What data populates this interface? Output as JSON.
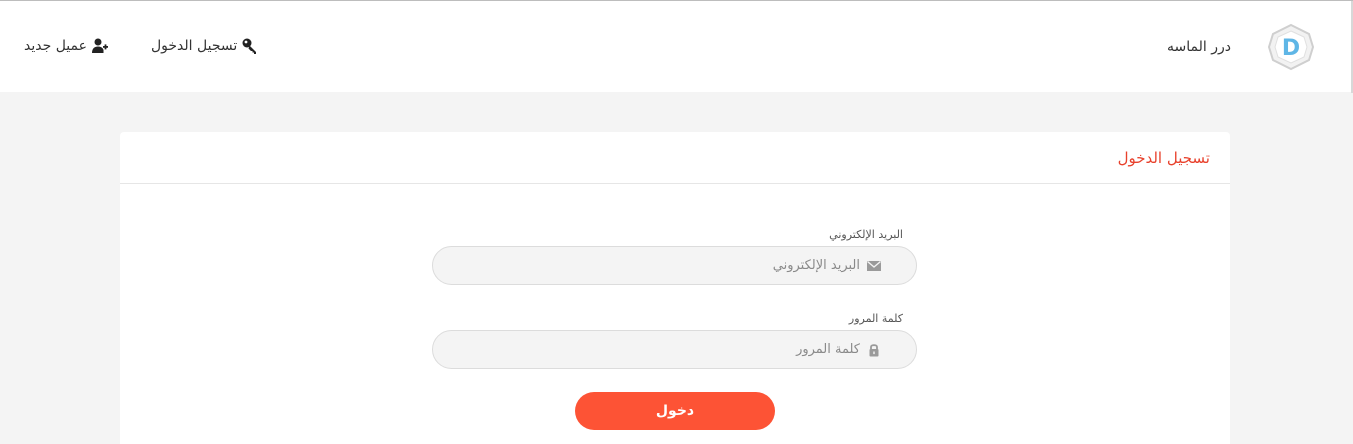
{
  "header": {
    "brand_name": "درر الماسه",
    "brand_logo_letter": "D",
    "nav": {
      "login_label": "تسجيل الدخول",
      "login_icon": "key-icon",
      "register_label": "عميل جديد",
      "register_icon": "add-user-icon"
    }
  },
  "login_card": {
    "title": "تسجيل الدخول",
    "email": {
      "label": "البريد الإلكتروني",
      "placeholder": "البريد الإلكتروني",
      "value": "",
      "icon": "envelope-icon"
    },
    "password": {
      "label": "كلمة المرور",
      "placeholder": "كلمة المرور",
      "value": "",
      "icon": "lock-icon"
    },
    "submit_label": "دخول"
  },
  "colors": {
    "accent": "#fd5335",
    "title": "#e8412c",
    "page_bg": "#f4f4f4",
    "logo_blue": "#5fb6e6"
  }
}
